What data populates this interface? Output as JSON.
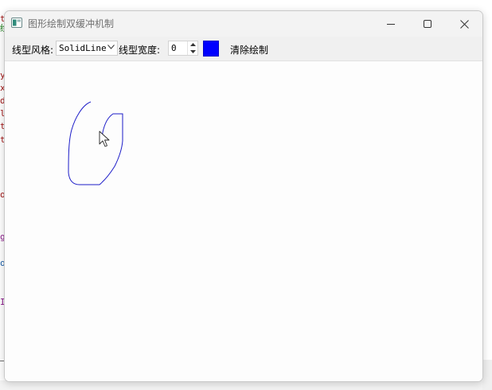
{
  "window": {
    "title": "图形绘制双缓冲机制"
  },
  "toolbar": {
    "line_style_label": "线型风格:",
    "line_style_value": "SolidLine",
    "line_width_label": "线型宽度:",
    "line_width_value": "0",
    "clear_label": "清除绘制"
  },
  "colors": {
    "pen_color": "#0000ff",
    "stroke_color": "#1c1cc8"
  },
  "background_editor": {
    "fragments": [
      "t",
      "绘",
      "y",
      "x",
      "d",
      "l",
      "t",
      "t",
      "o",
      "g",
      "o",
      "I"
    ]
  }
}
